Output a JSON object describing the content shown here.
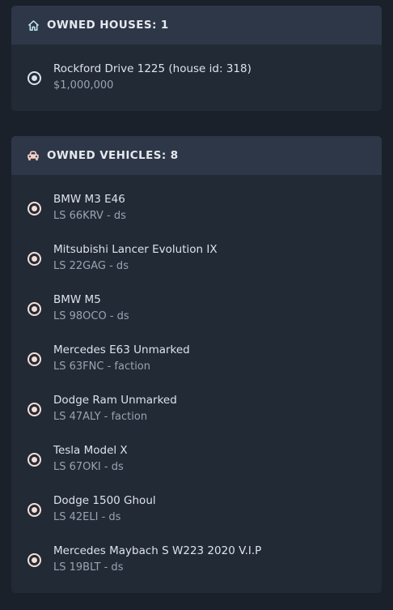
{
  "colors": {
    "page_background": "#1b212b",
    "panel_background": "#222a36",
    "header_background": "#2e3748",
    "house_icon": "#c7e8f2",
    "vehicle_icon": "#f2d0c4",
    "title_text": "#dde2ea",
    "subtitle_text": "#9aa3b0"
  },
  "houses": {
    "icon": "home-icon",
    "title": "OWNED HOUSES: 1",
    "items": [
      {
        "title": "Rockford Drive 1225 (house id: 318)",
        "subtitle": "$1,000,000",
        "selected": true
      }
    ]
  },
  "vehicles": {
    "icon": "car-icon",
    "title": "OWNED VEHICLES: 8",
    "items": [
      {
        "title": "BMW M3 E46",
        "subtitle": "LS 66KRV - ds",
        "selected": true
      },
      {
        "title": "Mitsubishi Lancer Evolution IX",
        "subtitle": "LS 22GAG - ds",
        "selected": true
      },
      {
        "title": "BMW M5",
        "subtitle": "LS 98OCO - ds",
        "selected": true
      },
      {
        "title": "Mercedes E63 Unmarked",
        "subtitle": "LS 63FNC - faction",
        "selected": true
      },
      {
        "title": "Dodge Ram Unmarked",
        "subtitle": "LS 47ALY - faction",
        "selected": true
      },
      {
        "title": "Tesla Model X",
        "subtitle": "LS 67OKI - ds",
        "selected": true
      },
      {
        "title": "Dodge 1500 Ghoul",
        "subtitle": "LS 42ELI - ds",
        "selected": true
      },
      {
        "title": "Mercedes Maybach S W223 2020 V.I.P",
        "subtitle": "LS 19BLT - ds",
        "selected": true
      }
    ]
  }
}
